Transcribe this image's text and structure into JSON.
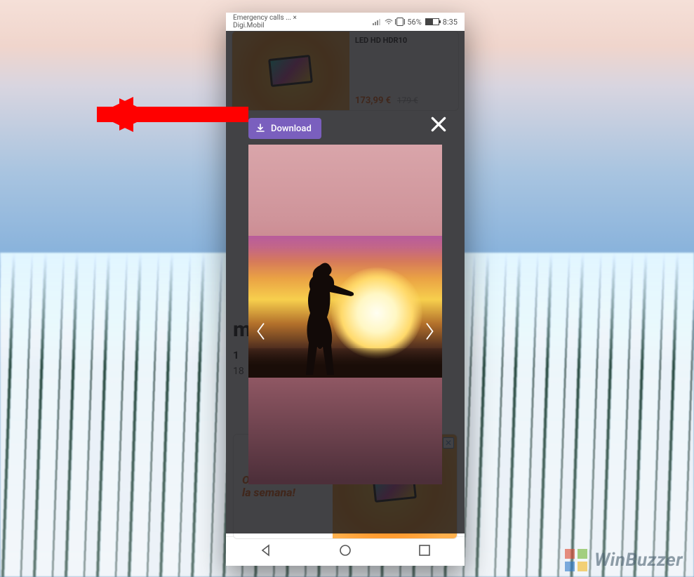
{
  "status": {
    "carrier_line1": "Emergency calls ... ×",
    "carrier_line2": "Digi.Mobil",
    "battery_pct": "56%",
    "time": "8:35"
  },
  "overlay": {
    "download_label": "Download"
  },
  "ad_top": {
    "product_line": "LED HD HDR10",
    "price": "173,99 €",
    "old_price": "179 €"
  },
  "behind": {
    "letter": "m",
    "line1": "1",
    "line2": "18"
  },
  "ad_bottom": {
    "line1": "Ofertas de",
    "line2": "la semana!"
  },
  "watermark": {
    "text": "WinBuzzer"
  },
  "colors": {
    "accent_purple": "#7a5fbe",
    "accent_orange": "#f36a1f",
    "arrow_red": "#ff0000"
  }
}
